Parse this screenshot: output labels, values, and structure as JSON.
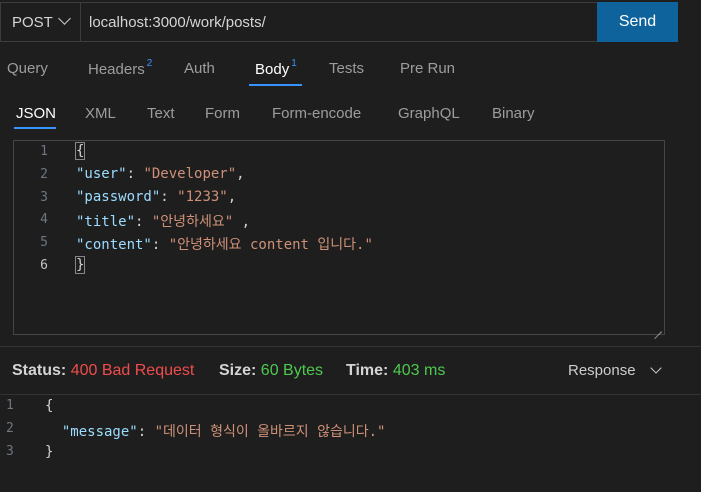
{
  "request": {
    "method": "POST",
    "url": "localhost:3000/work/posts/",
    "send_label": "Send"
  },
  "tabs": [
    {
      "label": "Query",
      "badge": ""
    },
    {
      "label": "Headers",
      "badge": "2"
    },
    {
      "label": "Auth",
      "badge": ""
    },
    {
      "label": "Body",
      "badge": "1",
      "active": true
    },
    {
      "label": "Tests",
      "badge": ""
    },
    {
      "label": "Pre Run",
      "badge": ""
    }
  ],
  "body_tabs": [
    "JSON",
    "XML",
    "Text",
    "Form",
    "Form-encode",
    "GraphQL",
    "Binary"
  ],
  "editor": {
    "line_numbers": [
      "1",
      "2",
      "3",
      "4",
      "5",
      "6"
    ],
    "lines": {
      "open": "{",
      "user_key": "\"user\"",
      "user_val": "\"Developer\"",
      "password_key": "\"password\"",
      "password_val": "\"1233\"",
      "title_key": "\"title\"",
      "title_val": "\"안녕하세요\"",
      "content_key": "\"content\"",
      "content_val": "\"안녕하세요 content 입니다.\"",
      "close": "}"
    }
  },
  "status": {
    "status_label": "Status:",
    "status_value": "400 Bad Request",
    "size_label": "Size:",
    "size_value": "60 Bytes",
    "time_label": "Time:",
    "time_value": "403 ms",
    "response_select": "Response"
  },
  "response": {
    "line_numbers": [
      "1",
      "2",
      "3"
    ],
    "open": "{",
    "message_key": "\"message\"",
    "message_val": "\"데이터 형식이 올바르지 않습니다.\"",
    "close": "}"
  },
  "colors": {
    "accent": "#3794ff",
    "send_button": "#0e639c",
    "error": "#f14c4c",
    "success": "#4ec94e",
    "json_key": "#9cdcfe",
    "json_string": "#ce9178"
  }
}
